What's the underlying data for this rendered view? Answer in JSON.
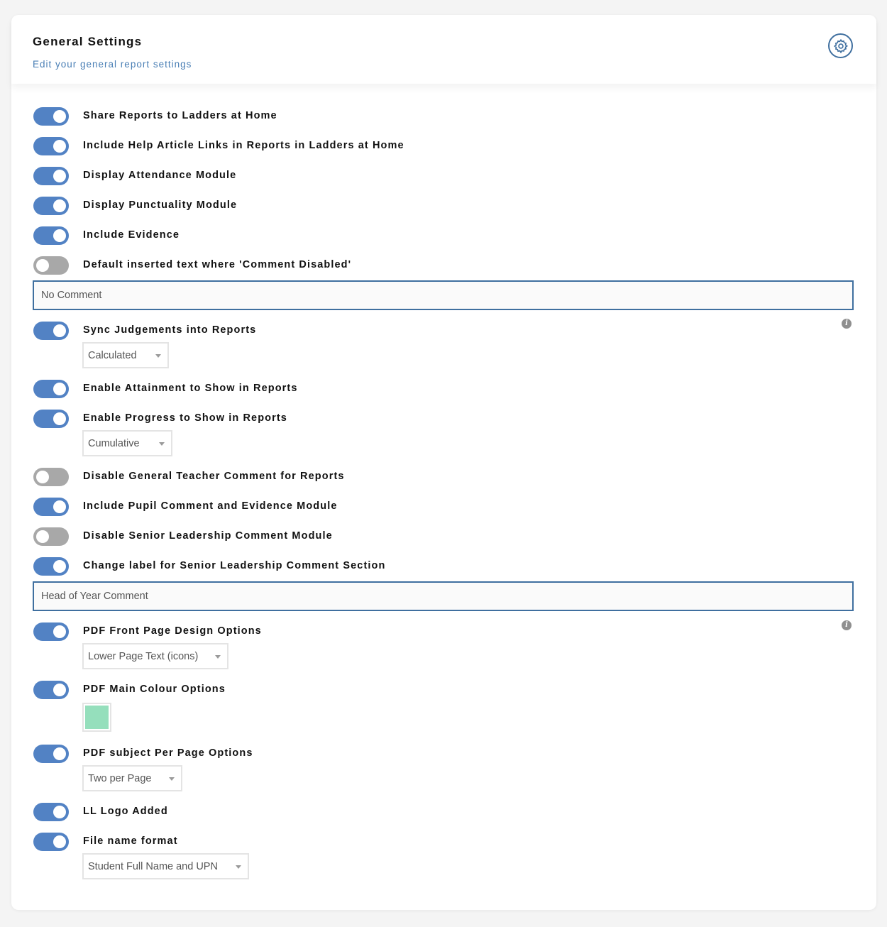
{
  "header": {
    "title": "General Settings",
    "subtitle": "Edit your general report settings",
    "settings_icon": "gear-icon"
  },
  "settings": [
    {
      "label": "Share Reports to Ladders at Home",
      "enabled": true
    },
    {
      "label": "Include Help Article Links in Reports in Ladders at Home",
      "enabled": true
    },
    {
      "label": "Display Attendance Module",
      "enabled": true
    },
    {
      "label": "Display Punctuality Module",
      "enabled": true
    },
    {
      "label": "Include Evidence",
      "enabled": true
    },
    {
      "label": "Default inserted text where 'Comment Disabled'",
      "enabled": false,
      "input_value": "No Comment"
    },
    {
      "label": "Sync Judgements into Reports",
      "enabled": true,
      "info_icon": "info-icon",
      "select_value": "Calculated"
    },
    {
      "label": "Enable Attainment to Show in Reports",
      "enabled": true
    },
    {
      "label": "Enable Progress to Show in Reports",
      "enabled": true,
      "select_value": "Cumulative"
    },
    {
      "label": "Disable General Teacher Comment for Reports",
      "enabled": false
    },
    {
      "label": "Include Pupil Comment and Evidence Module",
      "enabled": true
    },
    {
      "label": "Disable Senior Leadership Comment Module",
      "enabled": false
    },
    {
      "label": "Change label for Senior Leadership Comment Section",
      "enabled": true,
      "input_value": "Head of Year Comment"
    },
    {
      "label": "PDF Front Page Design Options",
      "enabled": true,
      "info_icon": "info-icon",
      "select_value": "Lower Page Text (icons)"
    },
    {
      "label": "PDF Main Colour Options",
      "enabled": true,
      "color_value": "#95dfbc"
    },
    {
      "label": "PDF subject Per Page Options",
      "enabled": true,
      "select_value": "Two per Page"
    },
    {
      "label": "LL Logo Added",
      "enabled": true
    },
    {
      "label": "File name format",
      "enabled": true,
      "select_value": "Student Full Name and UPN"
    }
  ],
  "colors": {
    "toggle_on": "#5282c4",
    "toggle_off": "#a8a8a8",
    "accent": "#3f6f9f"
  }
}
